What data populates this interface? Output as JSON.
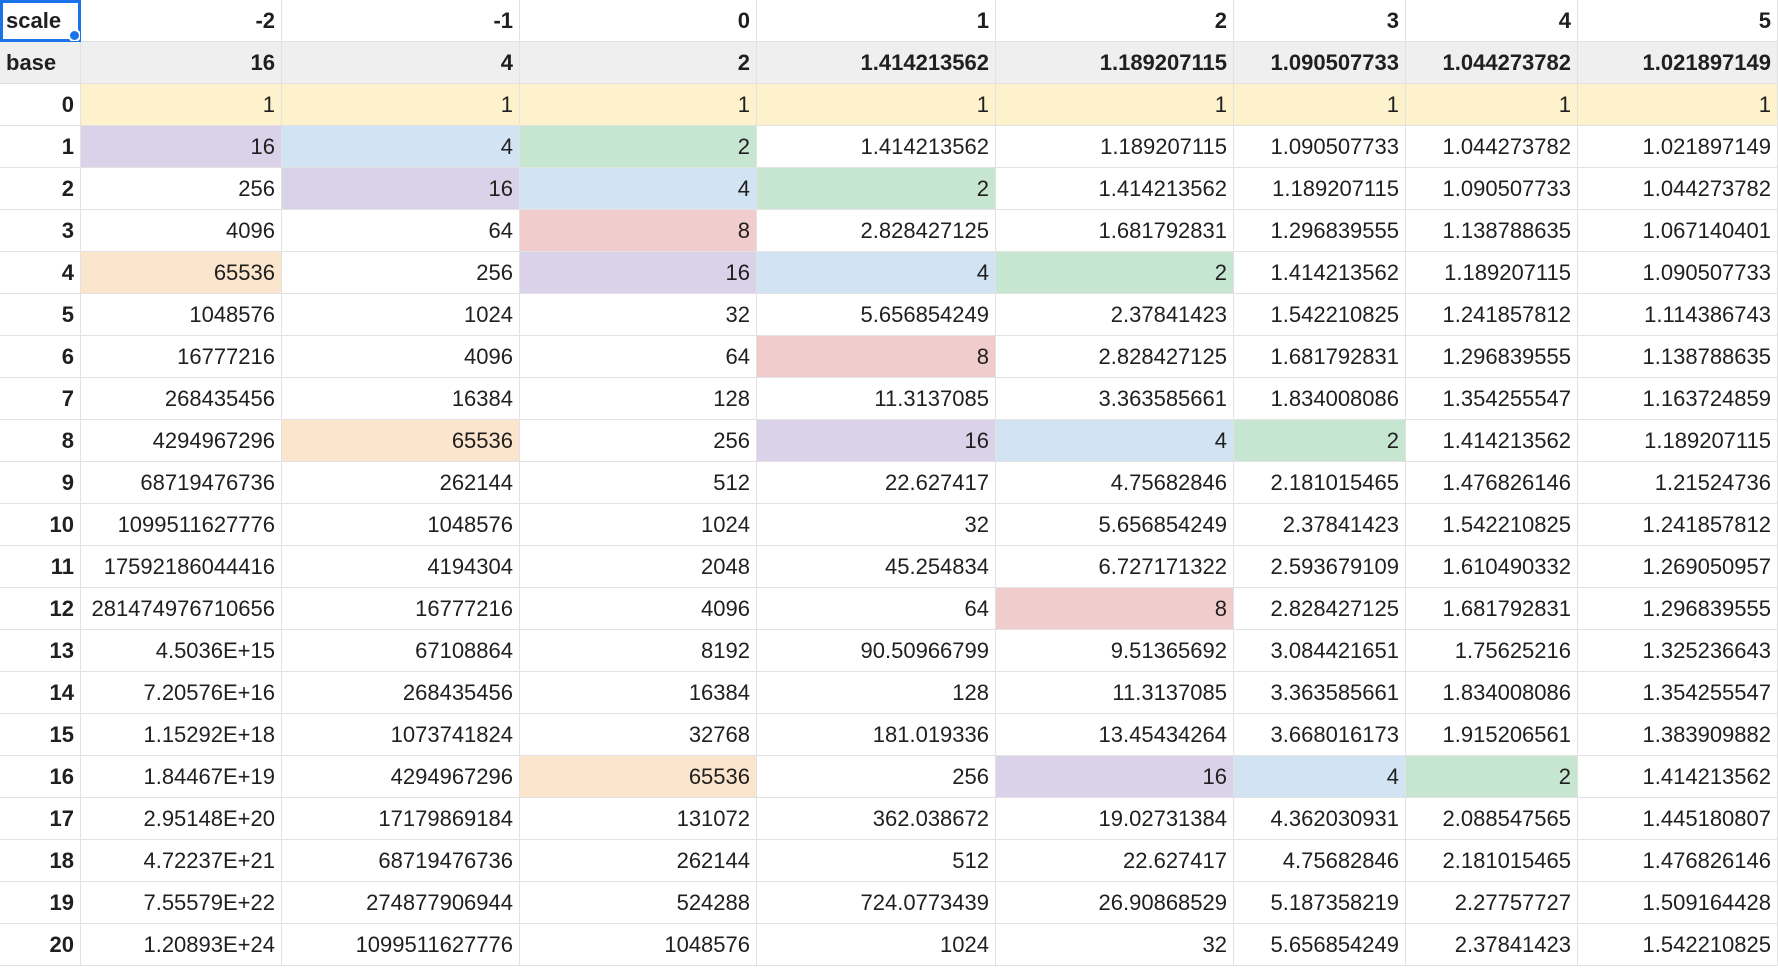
{
  "colors": {
    "header_grey": "#efefef",
    "yellow": "#fdf2cc",
    "purple": "#d9d2e9",
    "blue": "#d2e3f3",
    "green": "#c6e6d2",
    "red": "#f1cccc",
    "orange": "#fbe5cd",
    "selection": "#1a73e8",
    "gridline": "#e2e2e2"
  },
  "scale_row": {
    "label": "scale",
    "values": [
      "-2",
      "-1",
      "0",
      "1",
      "2",
      "3",
      "4",
      "5"
    ]
  },
  "base_row": {
    "label": "base",
    "values": [
      "16",
      "4",
      "2",
      "1.414213562",
      "1.189207115",
      "1.090507733",
      "1.044273782",
      "1.021897149"
    ]
  },
  "rows": [
    {
      "index": "0",
      "values": [
        "1",
        "1",
        "1",
        "1",
        "1",
        "1",
        "1",
        "1"
      ],
      "highlights": [
        "yellow",
        "yellow",
        "yellow",
        "yellow",
        "yellow",
        "yellow",
        "yellow",
        "yellow"
      ]
    },
    {
      "index": "1",
      "values": [
        "16",
        "4",
        "2",
        "1.414213562",
        "1.189207115",
        "1.090507733",
        "1.044273782",
        "1.021897149"
      ],
      "highlights": [
        "purple",
        "blue",
        "green",
        "",
        "",
        "",
        "",
        ""
      ]
    },
    {
      "index": "2",
      "values": [
        "256",
        "16",
        "4",
        "2",
        "1.414213562",
        "1.189207115",
        "1.090507733",
        "1.044273782"
      ],
      "highlights": [
        "",
        "purple",
        "blue",
        "green",
        "",
        "",
        "",
        ""
      ]
    },
    {
      "index": "3",
      "values": [
        "4096",
        "64",
        "8",
        "2.828427125",
        "1.681792831",
        "1.296839555",
        "1.138788635",
        "1.067140401"
      ],
      "highlights": [
        "",
        "",
        "red",
        "",
        "",
        "",
        "",
        ""
      ]
    },
    {
      "index": "4",
      "values": [
        "65536",
        "256",
        "16",
        "4",
        "2",
        "1.414213562",
        "1.189207115",
        "1.090507733"
      ],
      "highlights": [
        "orange",
        "",
        "purple",
        "blue",
        "green",
        "",
        "",
        ""
      ]
    },
    {
      "index": "5",
      "values": [
        "1048576",
        "1024",
        "32",
        "5.656854249",
        "2.37841423",
        "1.542210825",
        "1.241857812",
        "1.114386743"
      ],
      "highlights": [
        "",
        "",
        "",
        "",
        "",
        "",
        "",
        ""
      ]
    },
    {
      "index": "6",
      "values": [
        "16777216",
        "4096",
        "64",
        "8",
        "2.828427125",
        "1.681792831",
        "1.296839555",
        "1.138788635"
      ],
      "highlights": [
        "",
        "",
        "",
        "red",
        "",
        "",
        "",
        ""
      ]
    },
    {
      "index": "7",
      "values": [
        "268435456",
        "16384",
        "128",
        "11.3137085",
        "3.363585661",
        "1.834008086",
        "1.354255547",
        "1.163724859"
      ],
      "highlights": [
        "",
        "",
        "",
        "",
        "",
        "",
        "",
        ""
      ]
    },
    {
      "index": "8",
      "values": [
        "4294967296",
        "65536",
        "256",
        "16",
        "4",
        "2",
        "1.414213562",
        "1.189207115"
      ],
      "highlights": [
        "",
        "orange",
        "",
        "purple",
        "blue",
        "green",
        "",
        ""
      ]
    },
    {
      "index": "9",
      "values": [
        "68719476736",
        "262144",
        "512",
        "22.627417",
        "4.75682846",
        "2.181015465",
        "1.476826146",
        "1.21524736"
      ],
      "highlights": [
        "",
        "",
        "",
        "",
        "",
        "",
        "",
        ""
      ]
    },
    {
      "index": "10",
      "values": [
        "1099511627776",
        "1048576",
        "1024",
        "32",
        "5.656854249",
        "2.37841423",
        "1.542210825",
        "1.241857812"
      ],
      "highlights": [
        "",
        "",
        "",
        "",
        "",
        "",
        "",
        ""
      ]
    },
    {
      "index": "11",
      "values": [
        "17592186044416",
        "4194304",
        "2048",
        "45.254834",
        "6.727171322",
        "2.593679109",
        "1.610490332",
        "1.269050957"
      ],
      "highlights": [
        "",
        "",
        "",
        "",
        "",
        "",
        "",
        ""
      ]
    },
    {
      "index": "12",
      "values": [
        "281474976710656",
        "16777216",
        "4096",
        "64",
        "8",
        "2.828427125",
        "1.681792831",
        "1.296839555"
      ],
      "highlights": [
        "",
        "",
        "",
        "",
        "red",
        "",
        "",
        ""
      ]
    },
    {
      "index": "13",
      "values": [
        "4.5036E+15",
        "67108864",
        "8192",
        "90.50966799",
        "9.51365692",
        "3.084421651",
        "1.75625216",
        "1.325236643"
      ],
      "highlights": [
        "",
        "",
        "",
        "",
        "",
        "",
        "",
        ""
      ]
    },
    {
      "index": "14",
      "values": [
        "7.20576E+16",
        "268435456",
        "16384",
        "128",
        "11.3137085",
        "3.363585661",
        "1.834008086",
        "1.354255547"
      ],
      "highlights": [
        "",
        "",
        "",
        "",
        "",
        "",
        "",
        ""
      ]
    },
    {
      "index": "15",
      "values": [
        "1.15292E+18",
        "1073741824",
        "32768",
        "181.019336",
        "13.45434264",
        "3.668016173",
        "1.915206561",
        "1.383909882"
      ],
      "highlights": [
        "",
        "",
        "",
        "",
        "",
        "",
        "",
        ""
      ]
    },
    {
      "index": "16",
      "values": [
        "1.84467E+19",
        "4294967296",
        "65536",
        "256",
        "16",
        "4",
        "2",
        "1.414213562"
      ],
      "highlights": [
        "",
        "",
        "orange",
        "",
        "purple",
        "blue",
        "green",
        ""
      ]
    },
    {
      "index": "17",
      "values": [
        "2.95148E+20",
        "17179869184",
        "131072",
        "362.038672",
        "19.02731384",
        "4.362030931",
        "2.088547565",
        "1.445180807"
      ],
      "highlights": [
        "",
        "",
        "",
        "",
        "",
        "",
        "",
        ""
      ]
    },
    {
      "index": "18",
      "values": [
        "4.72237E+21",
        "68719476736",
        "262144",
        "512",
        "22.627417",
        "4.75682846",
        "2.181015465",
        "1.476826146"
      ],
      "highlights": [
        "",
        "",
        "",
        "",
        "",
        "",
        "",
        ""
      ]
    },
    {
      "index": "19",
      "values": [
        "7.55579E+22",
        "274877906944",
        "524288",
        "724.0773439",
        "26.90868529",
        "5.187358219",
        "2.27757727",
        "1.509164428"
      ],
      "highlights": [
        "",
        "",
        "",
        "",
        "",
        "",
        "",
        ""
      ]
    },
    {
      "index": "20",
      "values": [
        "1.20893E+24",
        "1099511627776",
        "1048576",
        "1024",
        "32",
        "5.656854249",
        "2.37841423",
        "1.542210825"
      ],
      "highlights": [
        "",
        "",
        "",
        "",
        "",
        "",
        "",
        ""
      ]
    }
  ]
}
